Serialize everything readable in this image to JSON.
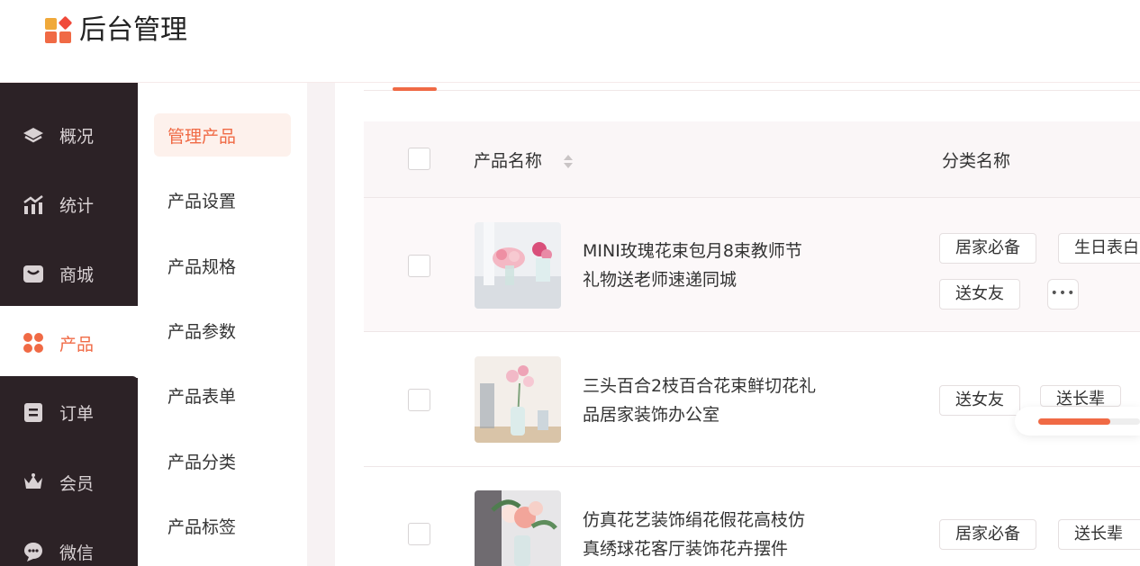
{
  "header": {
    "title": "后台管理"
  },
  "sidebar": {
    "items": [
      {
        "label": "概况",
        "icon": "layers-icon"
      },
      {
        "label": "统计",
        "icon": "chart-icon"
      },
      {
        "label": "商城",
        "icon": "store-icon"
      },
      {
        "label": "产品",
        "icon": "grid-icon",
        "active": true
      },
      {
        "label": "订单",
        "icon": "clipboard-icon"
      },
      {
        "label": "会员",
        "icon": "crown-icon"
      },
      {
        "label": "微信",
        "icon": "chat-icon"
      }
    ]
  },
  "subnav": {
    "items": [
      {
        "label": "管理产品",
        "active": true
      },
      {
        "label": "产品设置"
      },
      {
        "label": "产品规格"
      },
      {
        "label": "产品参数"
      },
      {
        "label": "产品表单"
      },
      {
        "label": "产品分类"
      },
      {
        "label": "产品标签"
      }
    ]
  },
  "table": {
    "columns": {
      "name": "产品名称",
      "category": "分类名称"
    },
    "rows": [
      {
        "name_line1": "MINI玫瑰花束包月8束教师节",
        "name_line2": "礼物送老师速递同城",
        "tags": [
          "居家必备",
          "生日表白",
          "送女友"
        ],
        "more": "•••"
      },
      {
        "name_line1": "三头百合2枝百合花束鲜切花礼",
        "name_line2": "品居家装饰办公室",
        "tags": [
          "送女友",
          "送长辈"
        ]
      },
      {
        "name_line1": "仿真花艺装饰绢花假花高枝仿",
        "name_line2": "真绣球花客厅装饰花卉摆件",
        "tags": [
          "居家必备",
          "送长辈"
        ]
      }
    ]
  },
  "colors": {
    "accent": "#f06a45",
    "sidebar_bg": "#2c2226"
  }
}
